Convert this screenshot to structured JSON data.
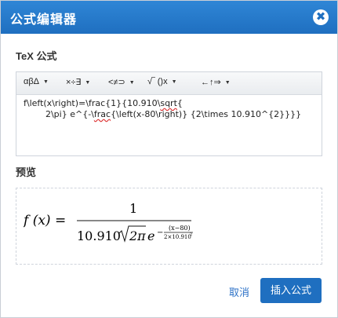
{
  "dialog": {
    "title": "公式编辑器",
    "close_glyph": "✖",
    "accent_color": "#1f6fc0"
  },
  "tex_section": {
    "label": "TeX 公式"
  },
  "toolbar": {
    "items": [
      {
        "label": "αβΔ",
        "caret": "▼"
      },
      {
        "label": "×÷∃",
        "caret": "▼"
      },
      {
        "label": "<≠⊃",
        "caret": "▼"
      },
      {
        "label": "√‾ ()x",
        "caret": "▼"
      },
      {
        "label": "←↑⇒",
        "caret": "▼"
      }
    ]
  },
  "tex_input": {
    "line1_pre": "f\\left(x\\right)=\\frac{1}{10.910\\",
    "line1_word": "sqrt",
    "line1_post": "{",
    "line2_pre": "        2\\pi} e^{-\\",
    "line2_word": "frac",
    "line2_post": "{\\left(x-80\\right)} {2\\times 10.910^{2}}}}"
  },
  "preview_section": {
    "label": "预览"
  },
  "preview_formula": {
    "lhs": "f (x) =",
    "numerator": "1",
    "coef": "10.910",
    "sqrt_content": "2π",
    "exp_base": "e",
    "exp_sign": "−",
    "exp_num": "(x−80)",
    "exp_den_coef": "2×10.910",
    "exp_den_power": "2"
  },
  "buttons": {
    "cancel": "取消",
    "insert": "插入公式"
  }
}
